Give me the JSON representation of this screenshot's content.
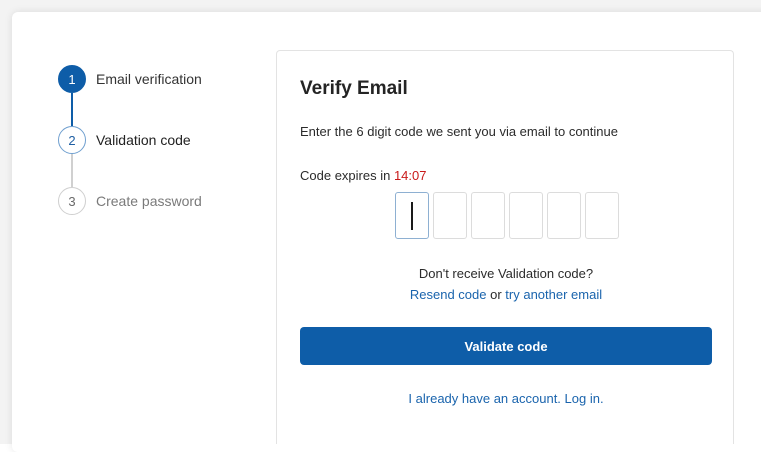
{
  "stepper": {
    "steps": [
      {
        "number": "1",
        "label": "Email verification",
        "state": "completed"
      },
      {
        "number": "2",
        "label": "Validation code",
        "state": "current"
      },
      {
        "number": "3",
        "label": "Create password",
        "state": "upcoming"
      }
    ]
  },
  "verify": {
    "title": "Verify Email",
    "subtitle": "Enter the 6 digit code we sent you via email to continue",
    "expires_prefix": "Code expires in ",
    "expires_time": "14:07",
    "code_digits": [
      "",
      "",
      "",
      "",
      "",
      ""
    ],
    "resend_question": "Don't receive Validation code?",
    "resend_link": "Resend code",
    "or_text": " or ",
    "try_another_link": "try another email",
    "validate_button": "Validate code",
    "login_link": "I already have an account. Log in."
  },
  "colors": {
    "primary": "#0e5da8",
    "link": "#1a64ad",
    "timer": "#c91a1a"
  }
}
